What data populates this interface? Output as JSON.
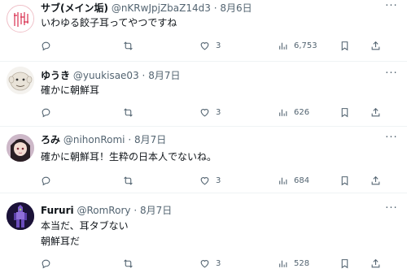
{
  "tweets": [
    {
      "name": "サブ(メイン垢)",
      "handle": "@nKRwJpjZbaZ14d3",
      "date": "8月6日",
      "lines": "いわゆる餃子耳ってやつですね",
      "likes": "3",
      "views": "6,753",
      "replies": "",
      "retweets": ""
    },
    {
      "name": "ゆうき",
      "handle": "@yuukisae03",
      "date": "8月7日",
      "lines": "確かに朝鮮耳",
      "likes": "3",
      "views": "626",
      "replies": "",
      "retweets": ""
    },
    {
      "name": "ろみ",
      "handle": "@nihonRomi",
      "date": "8月7日",
      "lines": "確かに朝鮮耳！生粋の日本人でないね。",
      "likes": "3",
      "views": "684",
      "replies": "",
      "retweets": ""
    },
    {
      "name": "Fururi",
      "handle": "@RomRory",
      "date": "8月7日",
      "lines": "本当だ、耳タブない\n朝鮮耳だ",
      "likes": "3",
      "views": "528",
      "replies": "",
      "retweets": ""
    }
  ],
  "separator": "·",
  "more_glyph": "···",
  "icons": {
    "reply": "reply-icon",
    "retweet": "retweet-icon",
    "like": "heart-icon",
    "views": "bar-chart-icon",
    "bookmark": "bookmark-icon",
    "share": "share-icon",
    "more": "more-icon"
  },
  "colors": {
    "text": "#0f1419",
    "secondary": "#536471",
    "border": "#eff3f4"
  }
}
